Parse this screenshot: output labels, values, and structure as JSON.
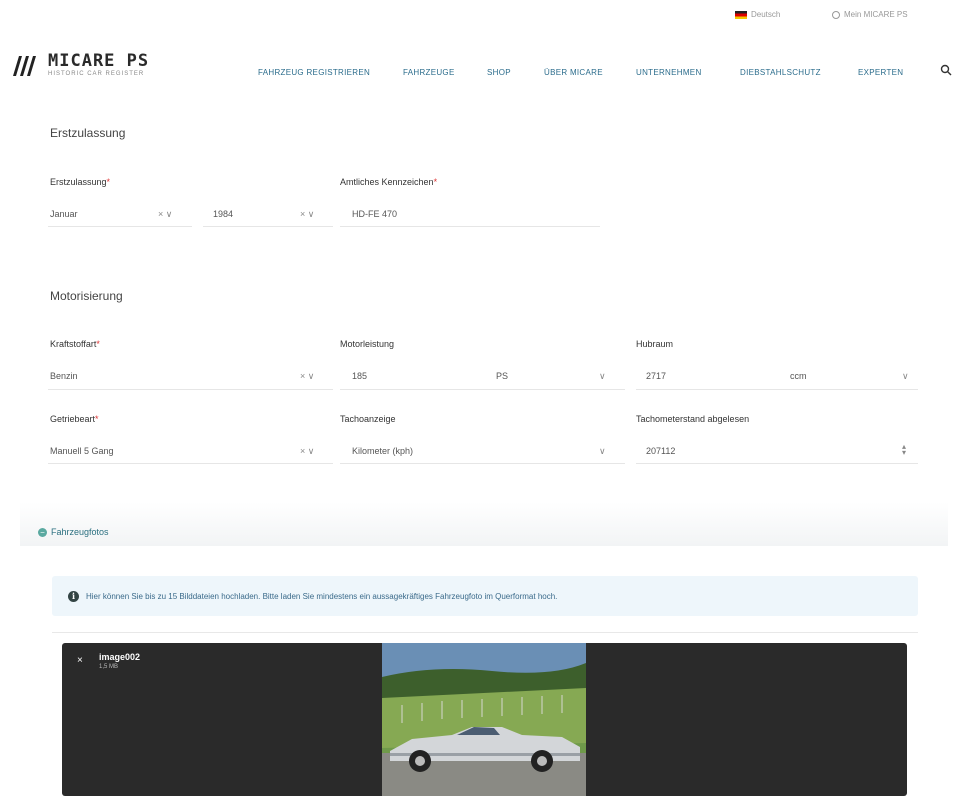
{
  "topbar": {
    "language": "Deutsch",
    "account": "Mein MICARE PS"
  },
  "brand": {
    "name": "MICARE PS",
    "tagline": "HISTORIC CAR REGISTER"
  },
  "nav": [
    {
      "label": "FAHRZEUG REGISTRIEREN"
    },
    {
      "label": "FAHRZEUGE"
    },
    {
      "label": "SHOP"
    },
    {
      "label": "ÜBER MICARE"
    },
    {
      "label": "UNTERNEHMEN"
    },
    {
      "label": "DIEBSTAHLSCHUTZ"
    },
    {
      "label": "EXPERTEN"
    }
  ],
  "sections": {
    "registration": "Erstzulassung",
    "engine": "Motorisierung"
  },
  "fields": {
    "first_reg": {
      "label": "Erstzulassung",
      "month": "Januar",
      "year": "1984"
    },
    "plate": {
      "label": "Amtliches Kennzeichen",
      "value": "HD-FE 470"
    },
    "fuel": {
      "label": "Kraftstoffart",
      "value": "Benzin"
    },
    "power": {
      "label": "Motorleistung",
      "value": "185",
      "unit": "PS"
    },
    "displacement": {
      "label": "Hubraum",
      "value": "2717",
      "unit": "ccm"
    },
    "transmission": {
      "label": "Getriebeart",
      "value": "Manuell 5 Gang"
    },
    "speedo": {
      "label": "Tachoanzeige",
      "value": "Kilometer (kph)"
    },
    "odometer": {
      "label": "Tachometerstand abgelesen",
      "value": "207112"
    }
  },
  "photos": {
    "title": "Fahrzeugfotos",
    "info": "Hier können Sie bis zu 15 Bilddateien hochladen. Bitte laden Sie mindestens ein aussagekräftiges Fahrzeugfoto im Querformat hoch.",
    "file": {
      "name": "image002",
      "size": "1,5 MB"
    }
  },
  "colors": {
    "accent": "#2b6c8c",
    "required": "#d33333",
    "info_bg": "#eef6fb"
  }
}
